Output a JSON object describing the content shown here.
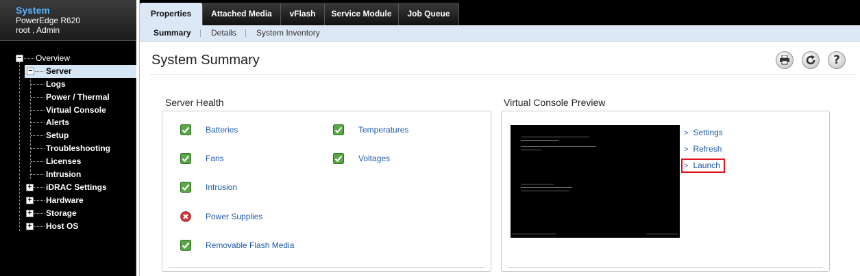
{
  "system": {
    "title": "System",
    "model": "PowerEdge R620",
    "user": "root , Admin"
  },
  "tree": {
    "overview": "Overview",
    "server": "Server",
    "children": [
      "Logs",
      "Power / Thermal",
      "Virtual Console",
      "Alerts",
      "Setup",
      "Troubleshooting",
      "Licenses",
      "Intrusion"
    ],
    "others": [
      "iDRAC Settings",
      "Hardware",
      "Storage",
      "Host OS"
    ]
  },
  "tabs": [
    "Properties",
    "Attached Media",
    "vFlash",
    "Service Module",
    "Job Queue"
  ],
  "subtabs": [
    "Summary",
    "Details",
    "System Inventory"
  ],
  "page_title": "System Summary",
  "toolbar": {
    "print_icon": "printer-icon",
    "refresh_icon": "refresh-icon",
    "help_icon": "help-icon"
  },
  "server_health": {
    "title": "Server Health",
    "left": [
      {
        "label": "Batteries",
        "status": "ok"
      },
      {
        "label": "Fans",
        "status": "ok"
      },
      {
        "label": "Intrusion",
        "status": "ok"
      },
      {
        "label": "Power Supplies",
        "status": "error"
      },
      {
        "label": "Removable Flash Media",
        "status": "ok"
      }
    ],
    "right": [
      {
        "label": "Temperatures",
        "status": "ok"
      },
      {
        "label": "Voltages",
        "status": "ok"
      }
    ]
  },
  "console": {
    "title": "Virtual Console Preview",
    "links": [
      "Settings",
      "Refresh",
      "Launch"
    ]
  },
  "colors": {
    "link": "#1e5aa8",
    "ok": "#4a9a3a",
    "error": "#cc2a2a",
    "highlight": "#e0141e",
    "accent": "#5ab3ff"
  }
}
